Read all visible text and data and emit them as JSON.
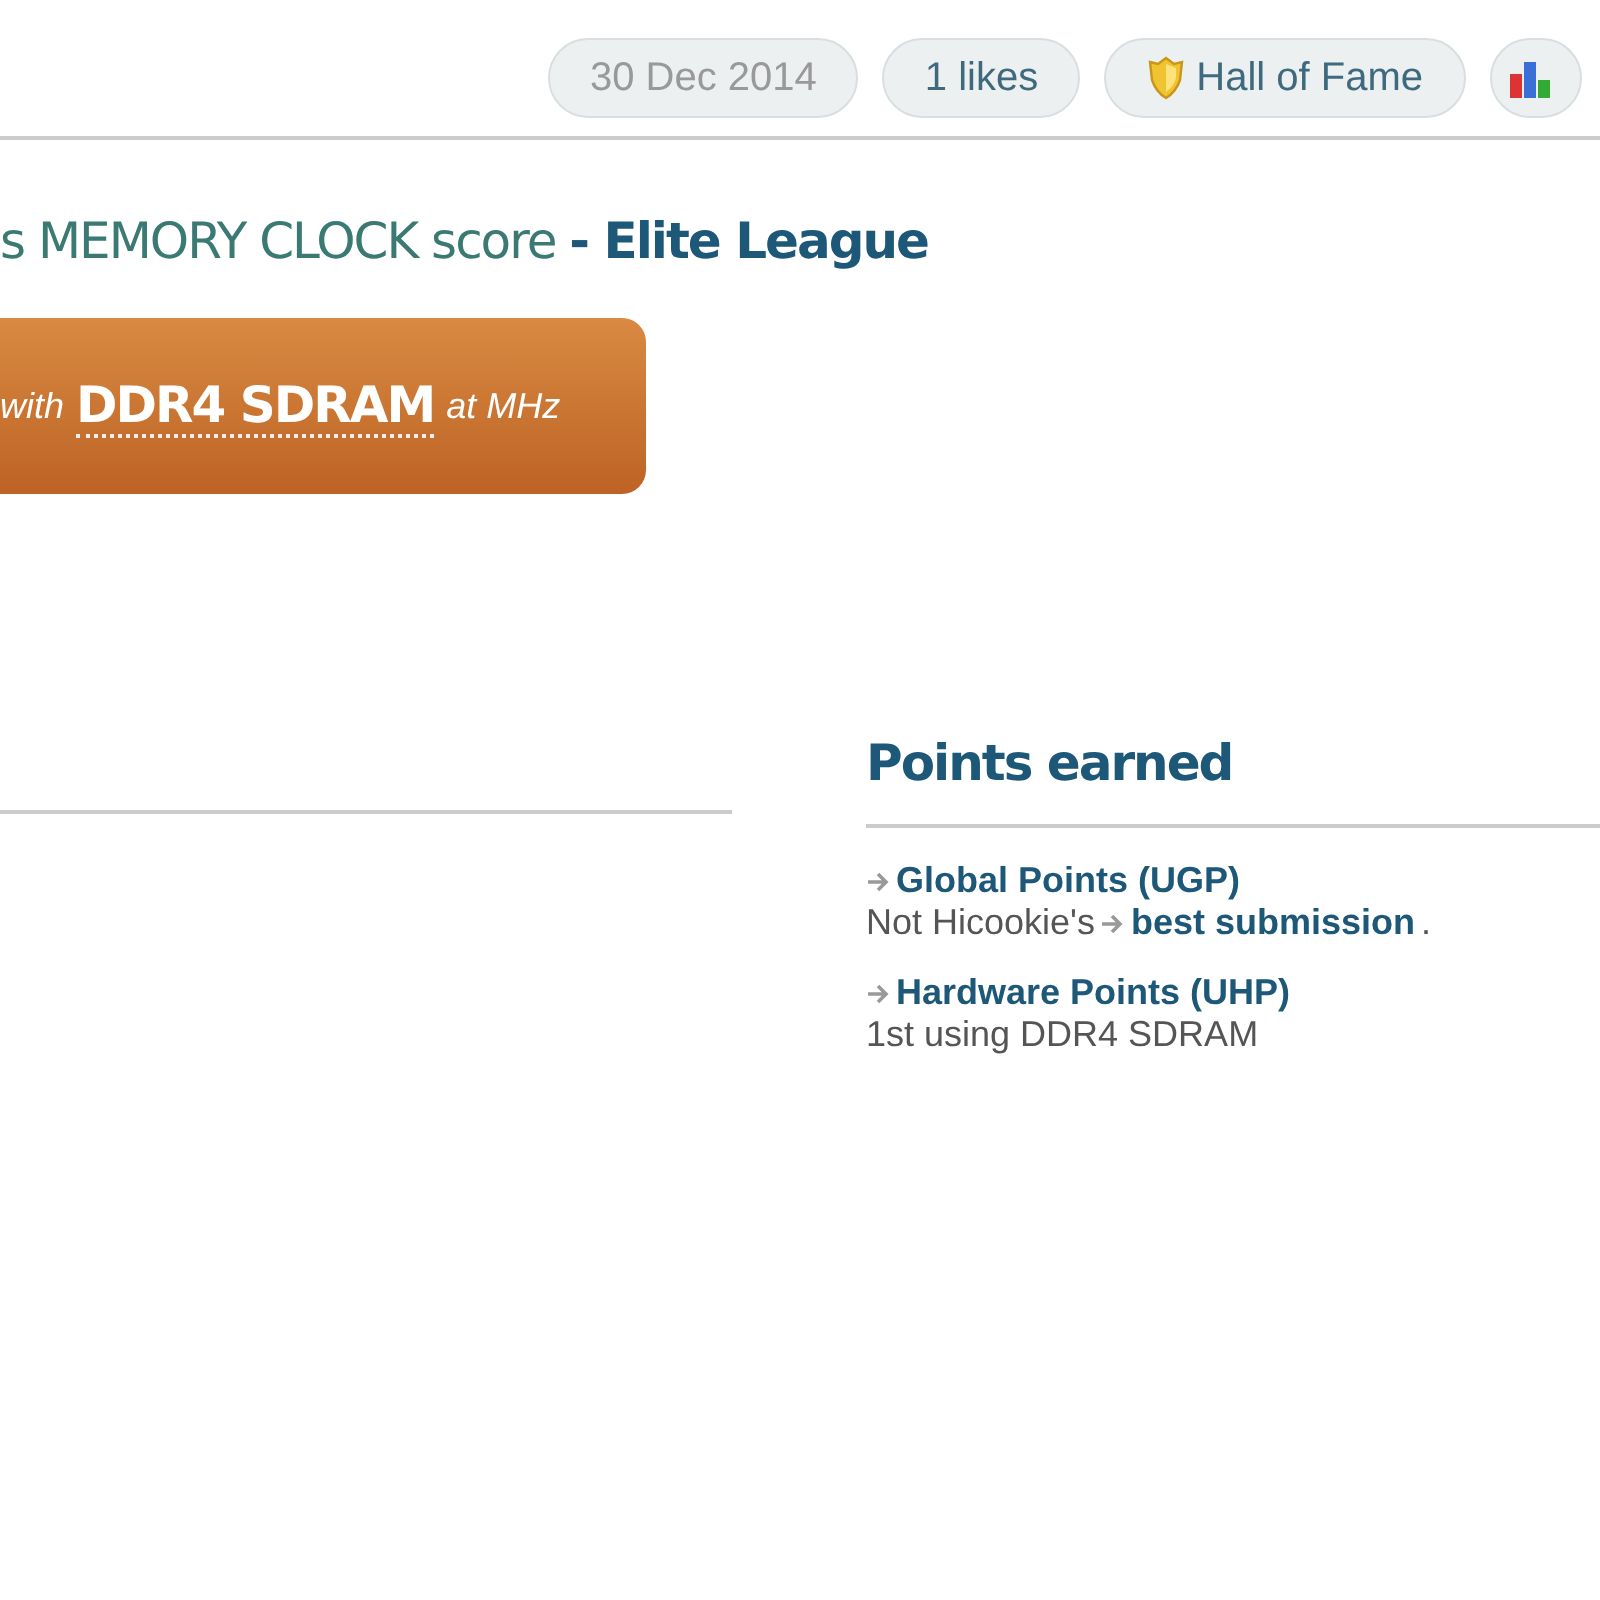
{
  "header_pills": [
    {
      "kind": "date",
      "label": "30 Dec 2014"
    },
    {
      "kind": "likes",
      "label": "1 likes"
    },
    {
      "kind": "award",
      "label": "Hall of Fame"
    },
    {
      "kind": "chart"
    }
  ],
  "title": {
    "text": "s MEMORY CLOCK score",
    "league": "- Elite League"
  },
  "banner": {
    "prefix": "with",
    "hardware": "DDR4 SDRAM",
    "suffix": "at MHz"
  },
  "points": {
    "heading": "Points earned",
    "items": [
      {
        "link": "Global Points (UGP)",
        "note": "Not Hicookie's",
        "note_link": "best submission",
        "note_end": "."
      },
      {
        "link": "Hardware Points (UHP)",
        "note": "1st using DDR4 SDRAM"
      }
    ]
  }
}
